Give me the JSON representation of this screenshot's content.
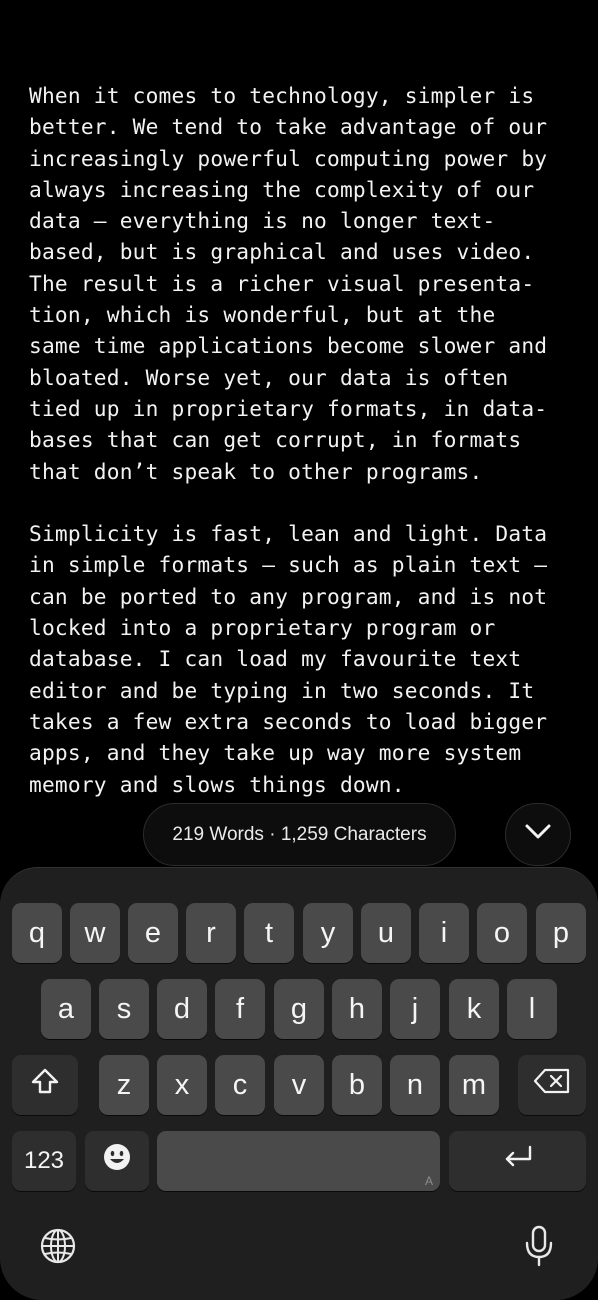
{
  "editor": {
    "paragraphs": [
      [
        "When it comes to technology, simpler is",
        "better. We tend to take advantage of our",
        "increasingly powerful computing power by",
        "always increasing the complexity of our",
        "data — everything is no longer text-",
        "based, but is graphical and uses video.",
        "The result is a richer visual presenta-",
        "tion, which is wonderful, but at the",
        "same time applications become slower and",
        "bloated. Worse yet, our data is often",
        "tied up in proprietary formats, in data-",
        "bases that can get corrupt, in formats",
        "that don’t speak to other programs."
      ],
      [
        "Simplicity is fast, lean and light. Data",
        "in simple formats — such as plain text —",
        "can be ported to any program, and is not",
        "locked into a proprietary program or",
        "database. I can load my favourite text",
        "editor and be typing in two seconds. It",
        "takes a few extra seconds to load bigger",
        "apps, and they take up way more system",
        "memory and slows things down."
      ]
    ]
  },
  "stats": {
    "label": "219 Words · 1,259 Characters"
  },
  "dismiss": {
    "icon": "chevron-down-icon"
  },
  "keyboard": {
    "row1": [
      "q",
      "w",
      "e",
      "r",
      "t",
      "y",
      "u",
      "i",
      "o",
      "p"
    ],
    "row2": [
      "a",
      "s",
      "d",
      "f",
      "g",
      "h",
      "j",
      "k",
      "l"
    ],
    "row3": [
      "z",
      "x",
      "c",
      "v",
      "b",
      "n",
      "m"
    ],
    "numbers_label": "123",
    "space_hint": "A",
    "icons": {
      "shift": "shift-icon",
      "delete": "delete-icon",
      "emoji": "emoji-icon",
      "return": "return-icon",
      "globe": "globe-icon",
      "mic": "microphone-icon"
    }
  }
}
